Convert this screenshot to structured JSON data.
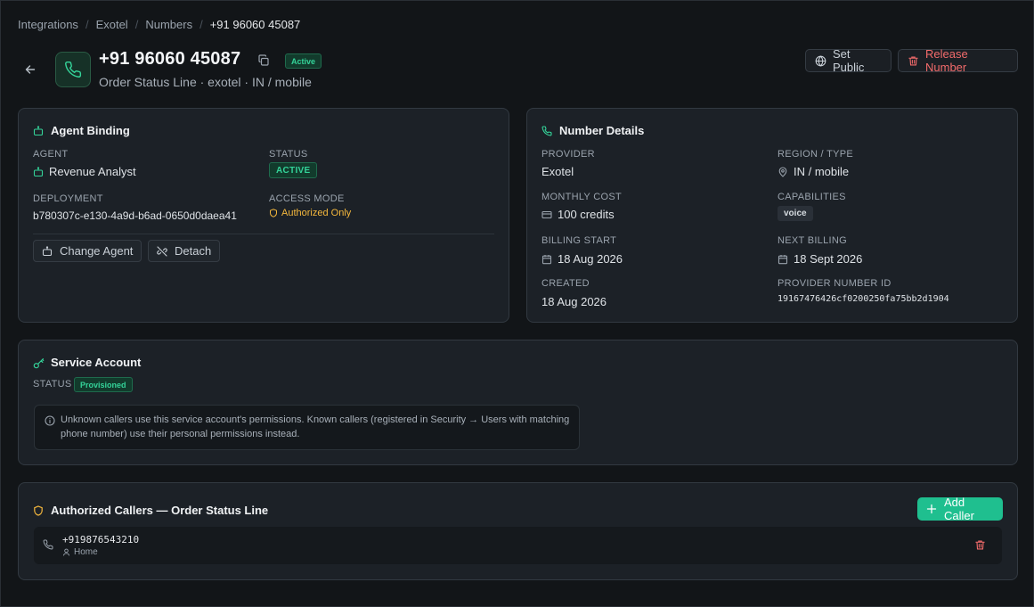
{
  "breadcrumb": [
    "Integrations",
    "Exotel",
    "Numbers",
    "+91 96060 45087"
  ],
  "header": {
    "title": "+91 96060 45087",
    "status_badge": "Active",
    "subtitle": "Order Status Line · exotel · IN / mobile",
    "set_public_label": "Set Public",
    "release_label": "Release Number"
  },
  "agent_binding": {
    "title": "Agent Binding",
    "agent_label": "AGENT",
    "agent_value": "Revenue Analyst",
    "status_label": "STATUS",
    "status_value": "ACTIVE",
    "deployment_label": "DEPLOYMENT",
    "deployment_value": "b780307c-e130-4a9d-b6ad-0650d0daea41",
    "access_label": "ACCESS MODE",
    "access_value": "Authorized Only",
    "change_agent_label": "Change Agent",
    "detach_label": "Detach"
  },
  "number_details": {
    "title": "Number Details",
    "provider_label": "PROVIDER",
    "provider_value": "Exotel",
    "region_label": "REGION / TYPE",
    "region_value": "IN / mobile",
    "cost_label": "MONTHLY COST",
    "cost_value": "100 credits",
    "capabilities_label": "CAPABILITIES",
    "capabilities_value": "voice",
    "billing_start_label": "BILLING START",
    "billing_start_value": "18 Aug 2026",
    "next_billing_label": "NEXT BILLING",
    "next_billing_value": "18 Sept 2026",
    "created_label": "CREATED",
    "created_value": "18 Aug 2026",
    "provider_id_label": "PROVIDER NUMBER ID",
    "provider_id_value": "19167476426cf0200250fa75bb2d1904"
  },
  "service_account": {
    "title": "Service Account",
    "status_label": "STATUS",
    "status_value": "Provisioned",
    "info_text": "Unknown callers use this service account's permissions. Known callers (registered in Security → Users with matching phone number) use their personal permissions instead."
  },
  "authorized_callers": {
    "title": "Authorized Callers — Order Status Line",
    "add_label": "Add Caller",
    "callers": [
      {
        "number": "+919876543210",
        "label": "Home"
      }
    ]
  },
  "colors": {
    "accent": "#34d399",
    "danger": "#f26b6b",
    "warning": "#f5b83d",
    "background": "#121518",
    "card": "#1c2127"
  }
}
